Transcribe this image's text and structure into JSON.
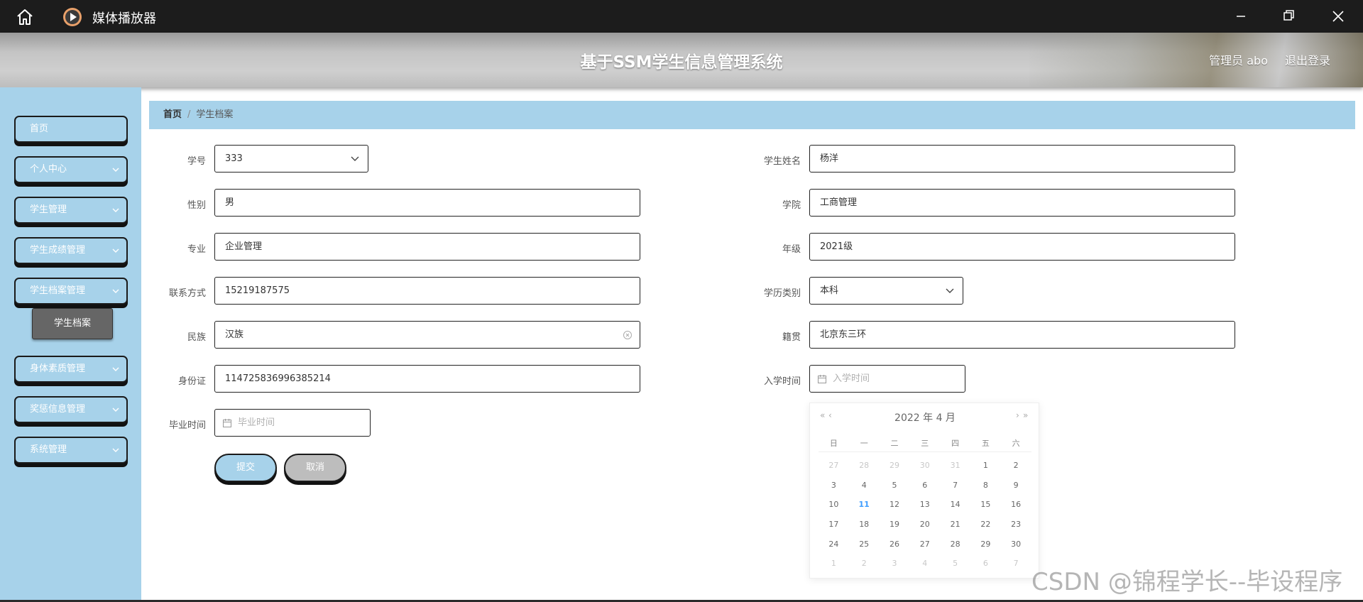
{
  "window": {
    "app_title": "媒体播放器",
    "controls": {
      "minimize": "minimize-icon",
      "restore": "restore-icon",
      "close": "close-icon"
    }
  },
  "header": {
    "system_title": "基于SSM学生信息管理系统",
    "user": "管理员 abo",
    "logout": "退出登录"
  },
  "sidebar": {
    "items": [
      {
        "label": "首页",
        "has_children": false
      },
      {
        "label": "个人中心",
        "has_children": true
      },
      {
        "label": "学生管理",
        "has_children": true
      },
      {
        "label": "学生成绩管理",
        "has_children": true
      },
      {
        "label": "学生档案管理",
        "has_children": true,
        "expanded": true
      },
      {
        "label": "身体素质管理",
        "has_children": true
      },
      {
        "label": "奖惩信息管理",
        "has_children": true
      },
      {
        "label": "系统管理",
        "has_children": true
      }
    ],
    "submenu_active": "学生档案"
  },
  "breadcrumb": {
    "home": "首页",
    "separator": "/",
    "current": "学生档案"
  },
  "form": {
    "student_no": {
      "label": "学号",
      "value": "333"
    },
    "student_name": {
      "label": "学生姓名",
      "value": "杨洋"
    },
    "gender": {
      "label": "性别",
      "value": "男"
    },
    "college": {
      "label": "学院",
      "value": "工商管理"
    },
    "major": {
      "label": "专业",
      "value": "企业管理"
    },
    "grade": {
      "label": "年级",
      "value": "2021级"
    },
    "contact": {
      "label": "联系方式",
      "value": "15219187575"
    },
    "education": {
      "label": "学历类别",
      "value": "本科"
    },
    "ethnicity": {
      "label": "民族",
      "value": "汉族"
    },
    "native_place": {
      "label": "籍贯",
      "value": "北京东三环"
    },
    "id_card": {
      "label": "身份证",
      "value": "114725836996385214"
    },
    "enroll_time": {
      "label": "入学时间",
      "placeholder": "入学时间"
    },
    "grad_time": {
      "label": "毕业时间",
      "placeholder": "毕业时间"
    },
    "submit": "提交",
    "cancel": "取消"
  },
  "datepicker": {
    "prev_year": "«",
    "prev_month": "‹",
    "next_month": "›",
    "next_year": "»",
    "year_month": "2022 年  4 月",
    "weekdays": [
      "日",
      "一",
      "二",
      "三",
      "四",
      "五",
      "六"
    ],
    "weeks": [
      [
        "27",
        "28",
        "29",
        "30",
        "31",
        "1",
        "2"
      ],
      [
        "3",
        "4",
        "5",
        "6",
        "7",
        "8",
        "9"
      ],
      [
        "10",
        "11",
        "12",
        "13",
        "14",
        "15",
        "16"
      ],
      [
        "17",
        "18",
        "19",
        "20",
        "21",
        "22",
        "23"
      ],
      [
        "24",
        "25",
        "26",
        "27",
        "28",
        "29",
        "30"
      ],
      [
        "1",
        "2",
        "3",
        "4",
        "5",
        "6",
        "7"
      ]
    ],
    "today": "11"
  },
  "watermark": "CSDN @锦程学长--毕设程序",
  "colors": {
    "sidebar": "#a7d2ea",
    "titlebar": "#1c1c1c",
    "today": "#409eff"
  }
}
